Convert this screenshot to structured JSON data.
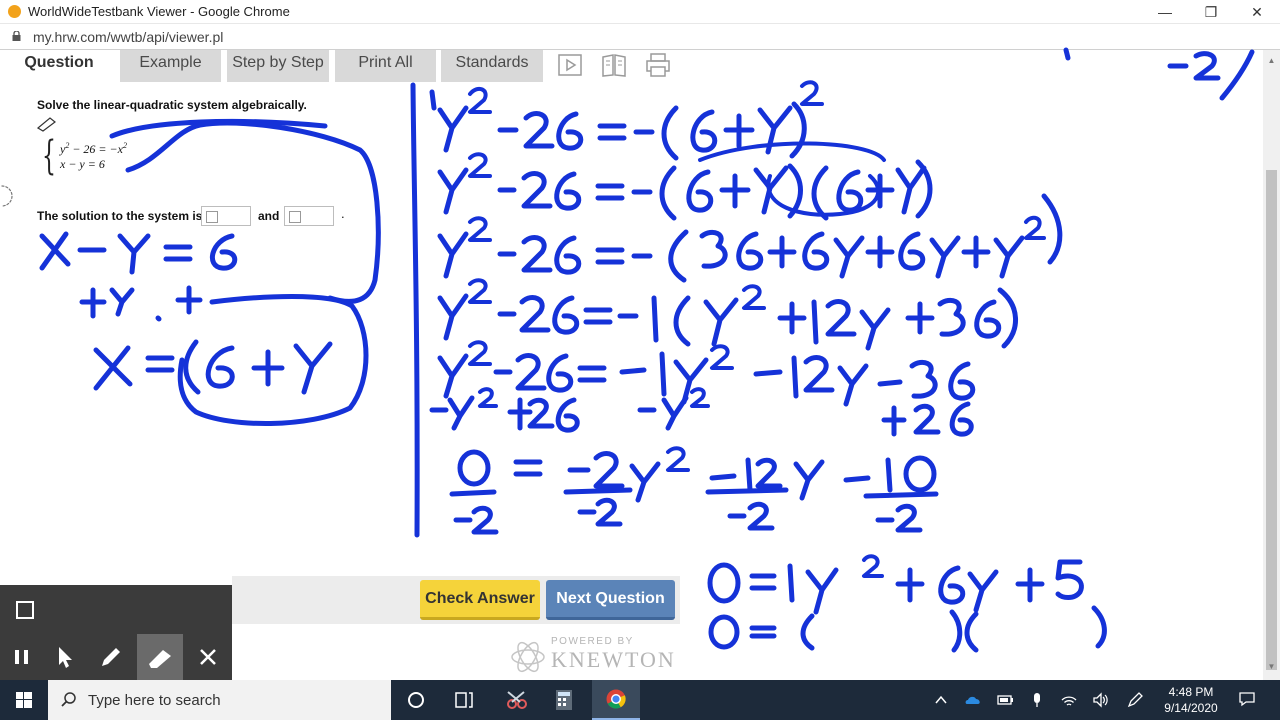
{
  "window": {
    "title": "WorldWideTestbank Viewer - Google Chrome",
    "url": "my.hrw.com/wwtb/api/viewer.pl"
  },
  "tabs": [
    "Question",
    "Example",
    "Step by Step",
    "Print All",
    "Standards"
  ],
  "question": {
    "prompt": "Solve the linear-quadratic system algebraically.",
    "eq1_left": "y",
    "eq1_mid": " − 26 = −x",
    "eq2": "x − y = 6",
    "solution_label": "The solution to the system is",
    "and_label": "and",
    "period": "."
  },
  "buttons": {
    "check": "Check Answer",
    "next": "Next Question"
  },
  "branding": {
    "powered_by": "POWERED BY",
    "name": "KNEWTON"
  },
  "taskbar": {
    "search_placeholder": "Type here to search",
    "time": "4:48 PM",
    "date": "9/14/2020"
  },
  "colors": {
    "ink": "#1532d8",
    "check_button": "#f5d33a",
    "next_button": "#5b84b8",
    "taskbar": "#1d2a3a"
  }
}
